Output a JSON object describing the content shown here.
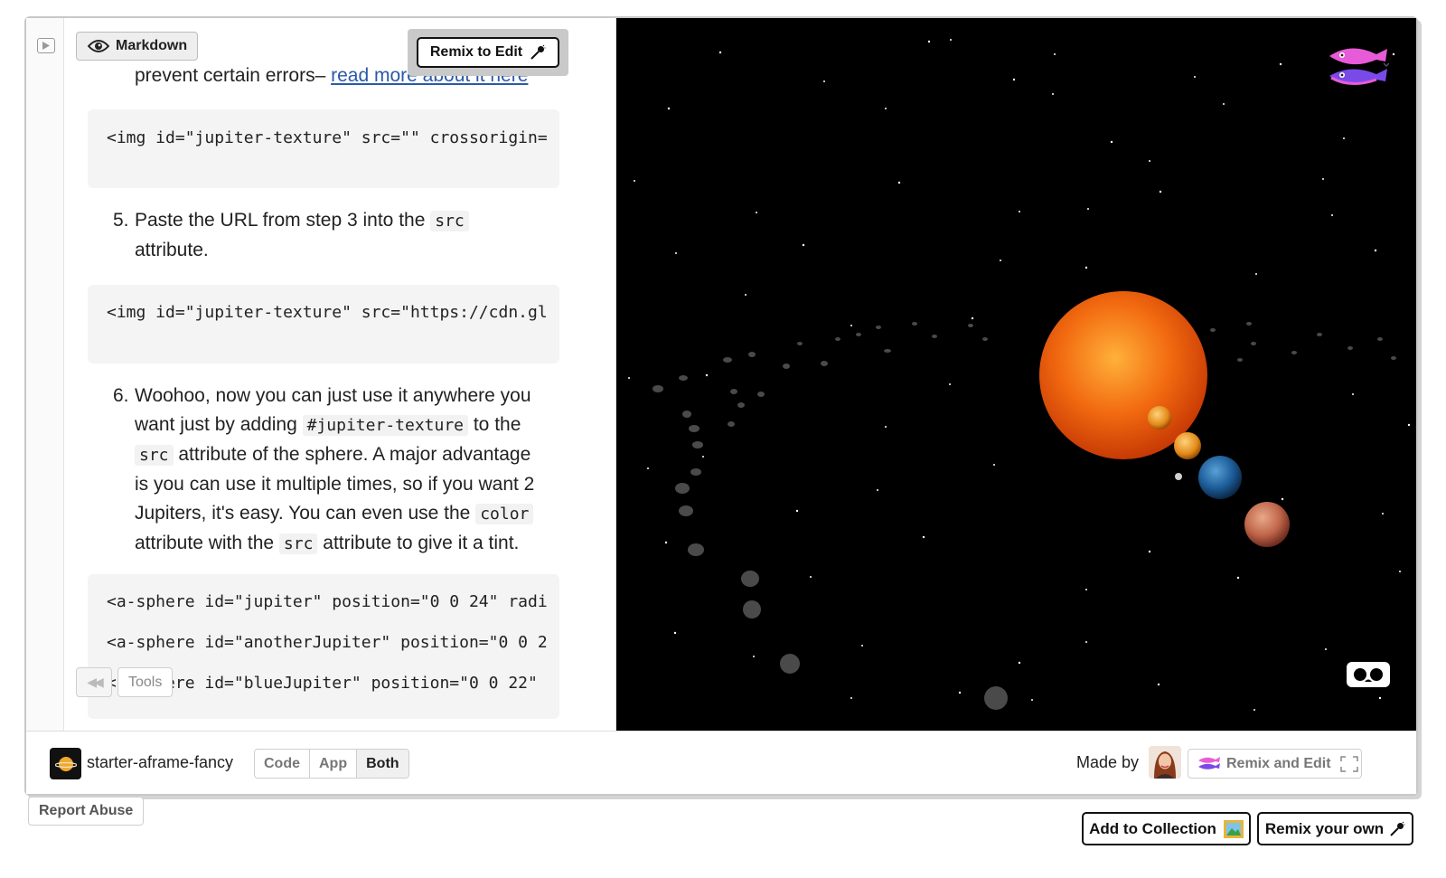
{
  "markdown_toggle": {
    "label": "Markdown",
    "icon": "eye-icon"
  },
  "remix_to_edit": {
    "label": "Remix to Edit",
    "icon": "microphone-icon"
  },
  "content": {
    "partial_line": {
      "text": "prevent certain errors– ",
      "link": "read more about it here"
    },
    "code1": "<img id=\"jupiter-texture\" src=\"\" crossorigin=",
    "step5": {
      "number": "5.",
      "before": "Paste the URL from step 3 into the ",
      "code": "src",
      "after": "attribute."
    },
    "code2": "<img id=\"jupiter-texture\" src=\"https://cdn.gl",
    "step6": {
      "number": "6.",
      "line1": "Woohoo, now you can just use it anywhere you",
      "line2_before": "want just by adding ",
      "line2_code": "#jupiter-texture",
      "line2_after": " to the",
      "line3_code": "src",
      "line3_after": " attribute of the sphere. A major advantage",
      "line4": "is you can use it multiple times, so if you want 2",
      "line5_before": "Jupiters, it's easy. You can even use the ",
      "line5_code": "color",
      "line6_before": "attribute with the ",
      "line6_code": "src",
      "line6_after": " attribute to give it a tint."
    },
    "code3": [
      "<a-sphere id=\"jupiter\" position=\"0 0 24\" radi",
      "<a-sphere id=\"anotherJupiter\" position=\"0 0 2",
      "<a-sphere id=\"blueJupiter\" position=\"0 0 22\""
    ]
  },
  "tools": {
    "rewind": "◀◀",
    "label": "Tools"
  },
  "bottom_bar": {
    "project_name": "starter-aframe-fancy",
    "views": [
      "Code",
      "App",
      "Both"
    ],
    "active_view": "Both",
    "made_by": "Made by",
    "remix_and_edit": "Remix and Edit"
  },
  "page_actions": {
    "report_abuse": "Report Abuse",
    "add_to_collection": "Add to Collection",
    "remix_your_own": "Remix your own"
  },
  "colors": {
    "accent_link": "#2a59a8",
    "scene_bg": "#000000",
    "sun": "#f26a10"
  }
}
